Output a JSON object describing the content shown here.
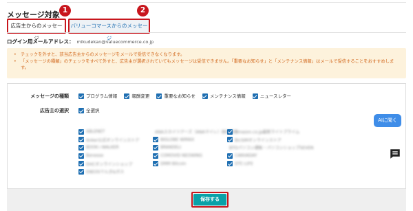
{
  "section": {
    "title": "メッセージ対象"
  },
  "badges": [
    "1",
    "2"
  ],
  "tabs": [
    {
      "label": "広告主からのメッセージ"
    },
    {
      "label": "バリューコマースからのメッセージ"
    }
  ],
  "login": {
    "label": "ログイン用メールアドレス：",
    "email": "mikudekan@valuecommerce.co.jp"
  },
  "notice": [
    "チェックを外すと、該当広告主からのメッセージをメールで受信できなくなります。",
    "「メッセージの種類」のチェックをすべて外すと、広告主が選択されていてもメッセージは受信できません。「重要なお知らせ」と「メンテナンス情報」はメールで受信することをおすすめします。"
  ],
  "message_types": {
    "label": "メッセージの種類",
    "options": [
      "プログラム情報",
      "報酬変更",
      "重要なお知らせ",
      "メンテナンス情報",
      "ニュースレター"
    ]
  },
  "advertisers": {
    "label": "広告主の選択",
    "select_all": "全選択",
    "col1": [
      "ABLENET",
      "Anker公式オンラインストア",
      "BOOK☆WALKER",
      "Benesse",
      "DHCオンラインショップ",
      "ENEOSでんき&ガス"
    ],
    "col2": [
      "ANAスカイツアーズ（ANAマイレ）国内旅行",
      "BIGLOBE WiMAX",
      "BRANDELI",
      "COMOVID NEOWING",
      "DMM Bitcoin",
      ""
    ],
    "col3": [
      "Amazon.co.jp最新ライトプライム",
      "BicSIMオンラインストア",
      "BTOパソコン通販・パソコンショップSEVEN",
      "CANVADAY",
      "DTC-LIFE",
      ""
    ]
  },
  "ai_button": {
    "label": "AIに聞く"
  },
  "save_button": {
    "label": "保存する"
  },
  "icons": {
    "chat": "chat-bubble-icon",
    "checkbox": "checkbox-checked-icon"
  },
  "colors": {
    "accent_red": "#c8161d",
    "checkbox_blue": "#1f6fb2",
    "save_teal": "#0aa1a8",
    "ai_blue": "#3f8de8",
    "notice_bg": "#fdf2dc",
    "notice_text": "#d2691e"
  }
}
